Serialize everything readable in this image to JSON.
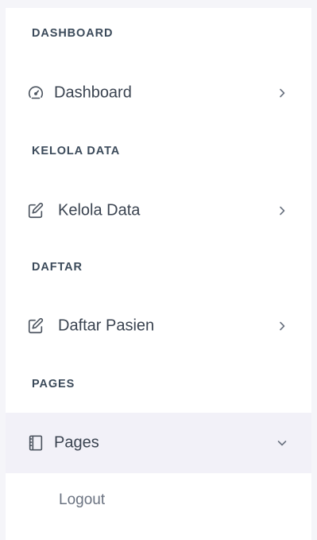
{
  "sidebar": {
    "sections": [
      {
        "header": "DASHBOARD",
        "item": {
          "label": "Dashboard",
          "icon": "speedometer-icon",
          "chevron": "chevron-right-icon"
        }
      },
      {
        "header": "KELOLA DATA",
        "item": {
          "label": "Kelola Data",
          "icon": "edit-icon",
          "chevron": "chevron-right-icon"
        }
      },
      {
        "header": "DAFTAR",
        "item": {
          "label": "Daftar Pasien",
          "icon": "edit-icon",
          "chevron": "chevron-right-icon"
        }
      },
      {
        "header": "PAGES",
        "item": {
          "label": "Pages",
          "icon": "book-icon",
          "chevron": "chevron-down-icon",
          "expanded": true,
          "subitems": [
            {
              "label": "Logout"
            }
          ]
        }
      }
    ]
  },
  "colors": {
    "background": "#f5f5f9",
    "panel": "#ffffff",
    "active_item": "#f2f1f8",
    "header_text": "#3b4a5a",
    "item_text": "#3a4350",
    "sub_text": "#6a7280"
  }
}
